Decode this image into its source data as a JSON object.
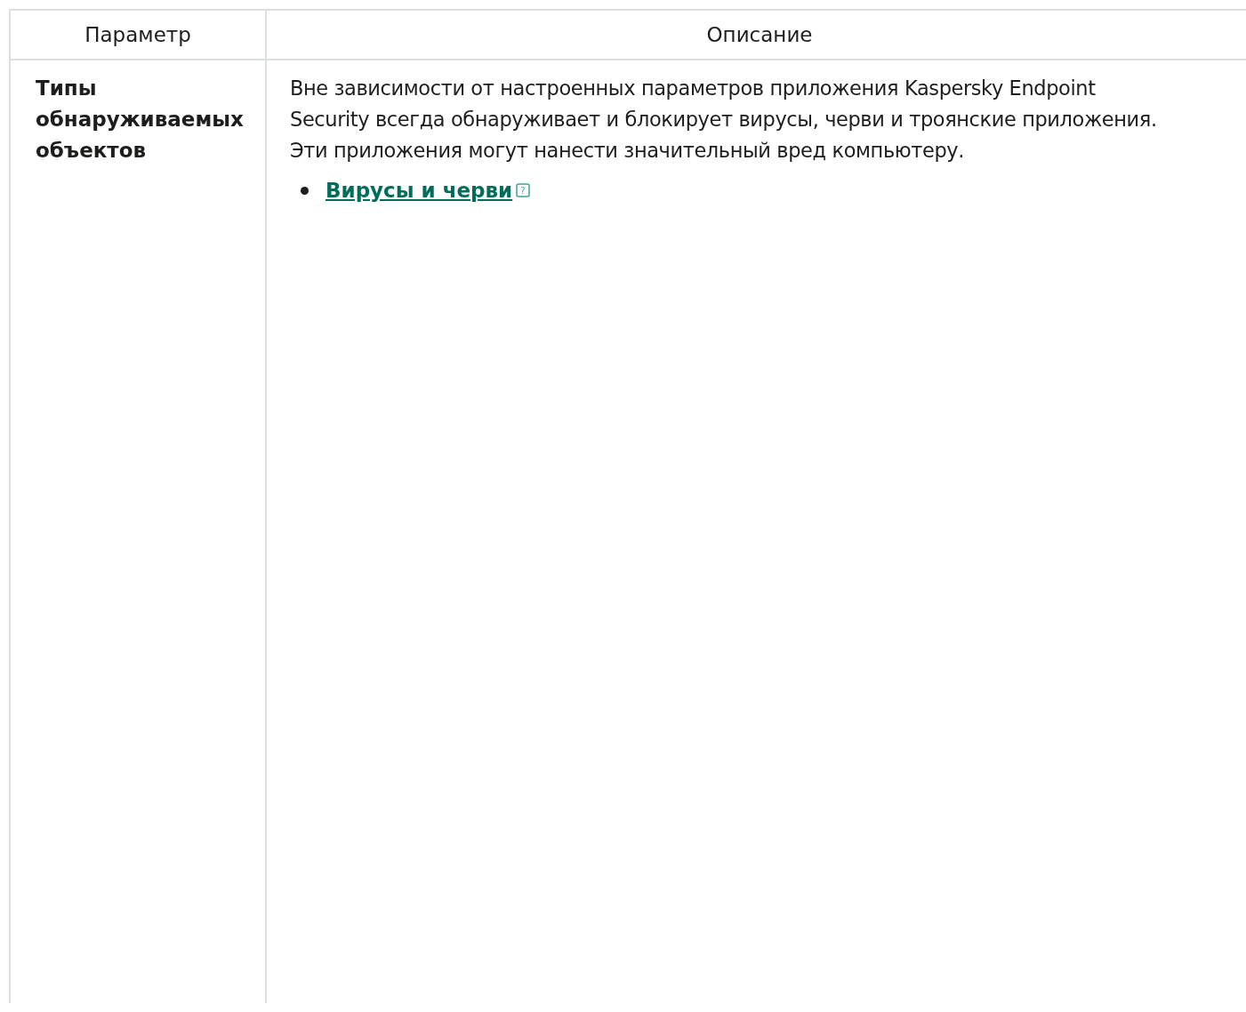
{
  "table": {
    "columns": [
      "Параметр",
      "Описание"
    ],
    "rows": [
      {
        "parameter": "Типы обнаруживаемых объектов",
        "description": "Вне зависимости от настроенных параметров приложения Kaspersky Endpoint Security всегда обнаруживает и блокирует вирусы, черви и троянские приложения. Эти приложения могут нанести значительный вред компьютеру.",
        "links": [
          {
            "text": "Вирусы и черви",
            "help_icon": "?"
          }
        ]
      }
    ]
  }
}
